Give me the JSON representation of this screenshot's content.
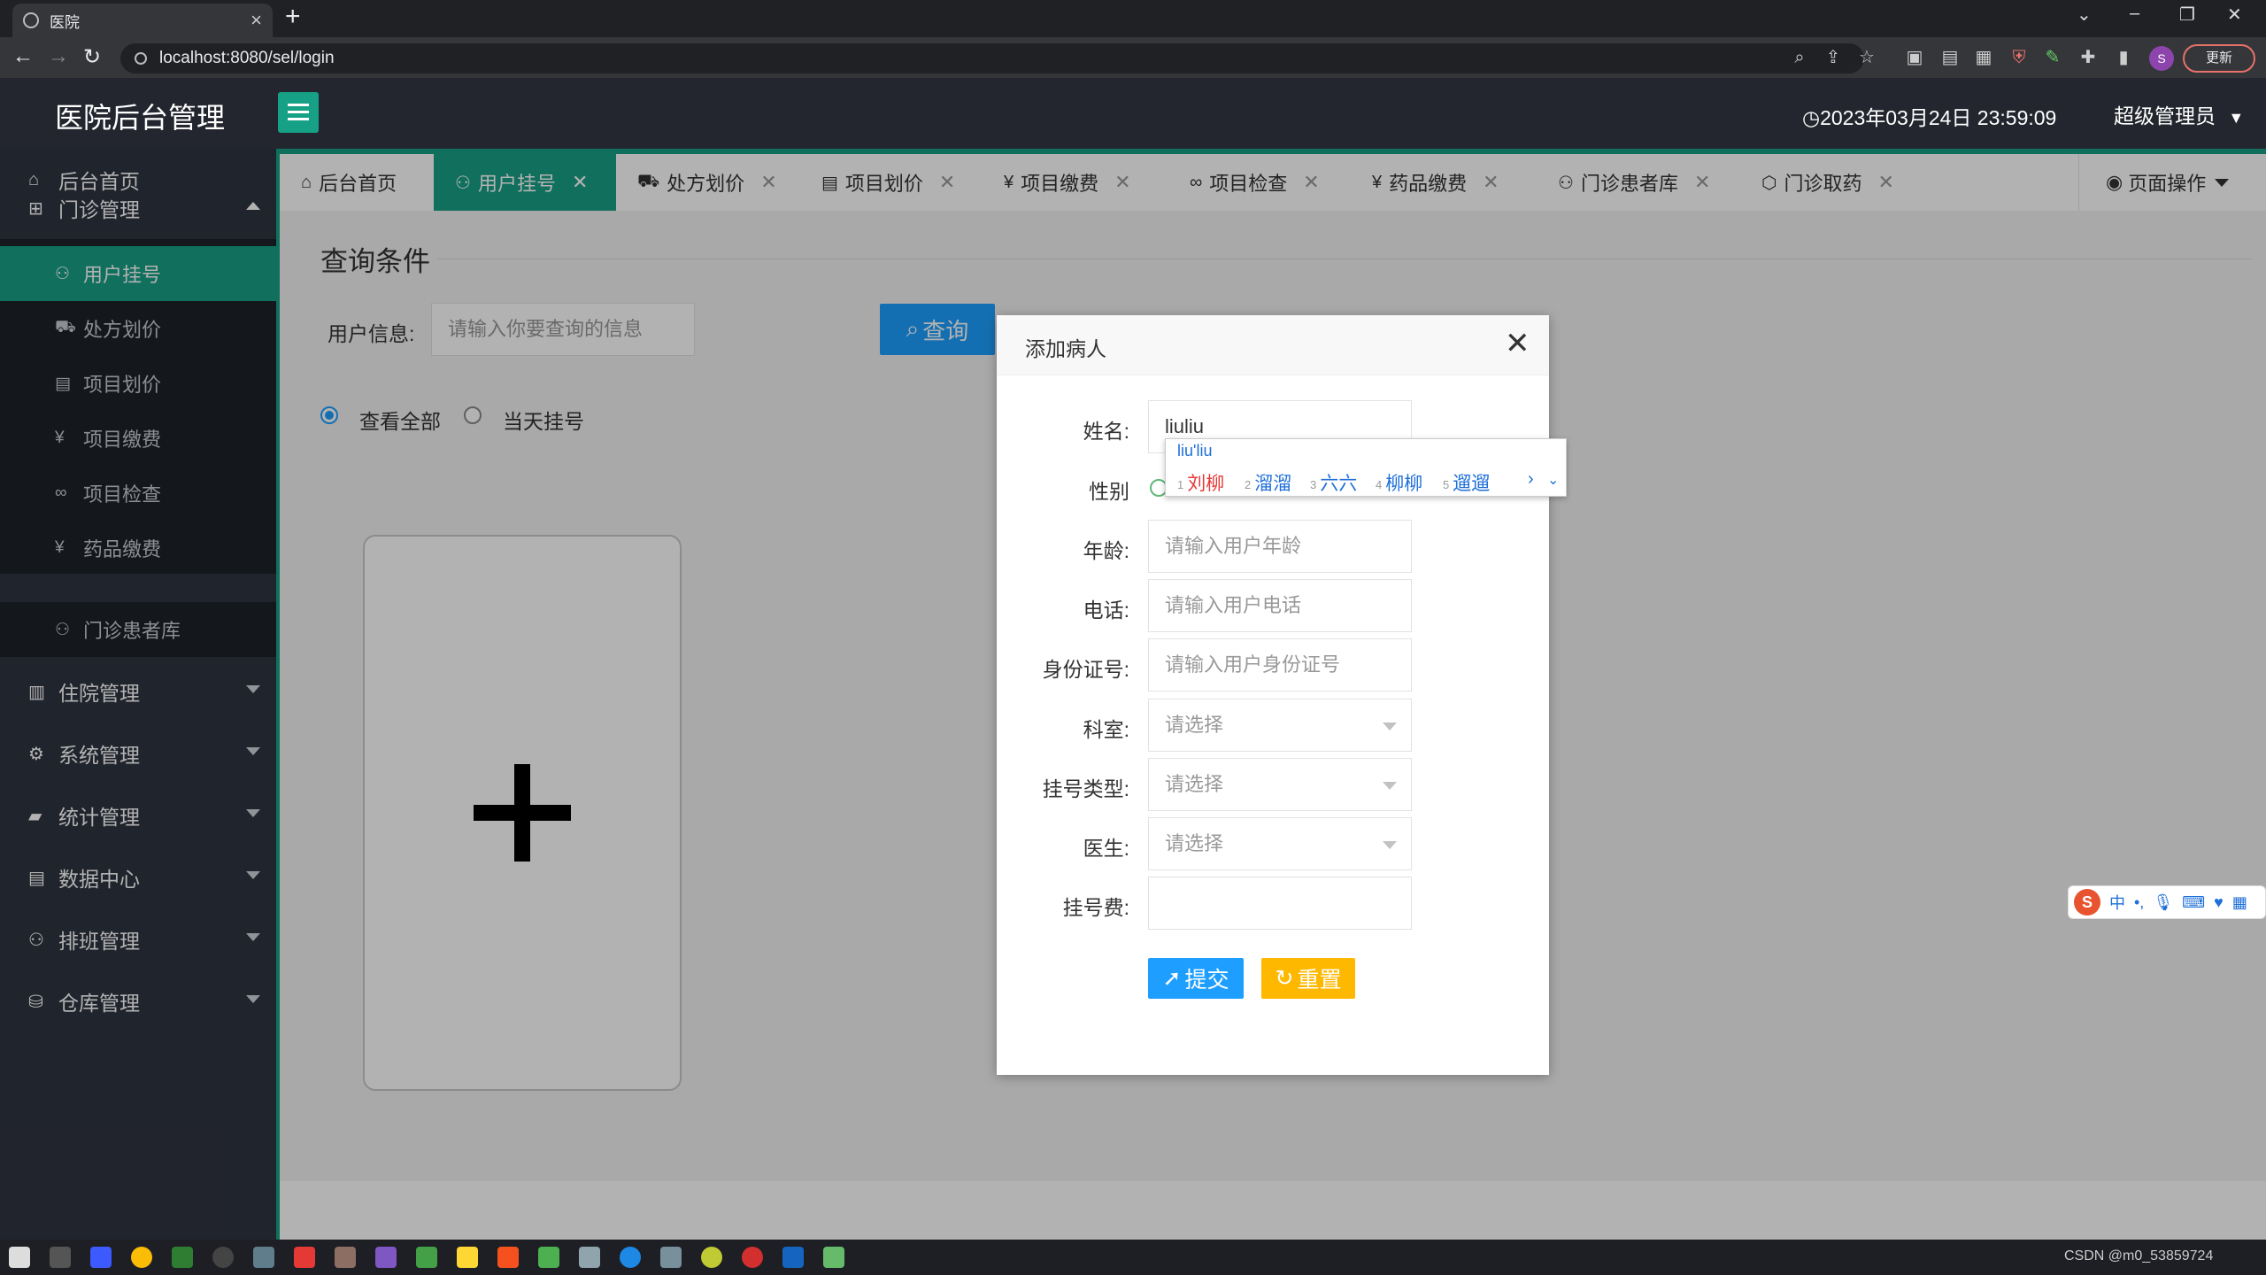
{
  "browser": {
    "tab_title": "医院",
    "url": "localhost:8080/sel/login",
    "update_label": "更新",
    "profile_initial": "S"
  },
  "app": {
    "title": "医院后台管理",
    "datetime": "2023年03月24日 23:59:09",
    "user": "超级管理员"
  },
  "sidebar": {
    "home": "后台首页",
    "outpatient": "门诊管理",
    "outpatient_items": [
      "用户挂号",
      "处方划价",
      "项目划价",
      "项目缴费",
      "项目检查",
      "药品缴费",
      "门诊患者库"
    ],
    "groups": [
      "住院管理",
      "系统管理",
      "统计管理",
      "数据中心",
      "排班管理",
      "仓库管理"
    ]
  },
  "tabs": [
    "后台首页",
    "用户挂号",
    "处方划价",
    "项目划价",
    "项目缴费",
    "项目检查",
    "药品缴费",
    "门诊患者库",
    "门诊取药"
  ],
  "page_ops": "页面操作",
  "query": {
    "title": "查询条件",
    "label": "用户信息:",
    "placeholder": "请输入你要查询的信息",
    "button": "查询",
    "radio_all": "查看全部",
    "radio_today": "当天挂号"
  },
  "modal": {
    "title": "添加病人",
    "fields": {
      "name_label": "姓名:",
      "name_value": "liuliu",
      "gender_label": "性别",
      "age_label": "年龄:",
      "age_placeholder": "请输入用户年龄",
      "phone_label": "电话:",
      "phone_placeholder": "请输入用户电话",
      "id_label": "身份证号:",
      "id_placeholder": "请输入用户身份证号",
      "dept_label": "科室:",
      "dept_placeholder": "请选择",
      "regtype_label": "挂号类型:",
      "regtype_placeholder": "请选择",
      "doctor_label": "医生:",
      "doctor_placeholder": "请选择",
      "fee_label": "挂号费:"
    },
    "submit": "提交",
    "reset": "重置"
  },
  "ime": {
    "composition": "liu'liu",
    "candidates": [
      "刘柳",
      "溜溜",
      "六六",
      "柳柳",
      "遛遛"
    ],
    "toolbar": "中"
  },
  "taskbar": {
    "tray": "CSDN @m0_53859724"
  },
  "colors": {
    "accent": "#17a086",
    "primary": "#1e9fff",
    "warn": "#ffb800",
    "header": "#23262e",
    "sidebar": "#2f3440"
  }
}
